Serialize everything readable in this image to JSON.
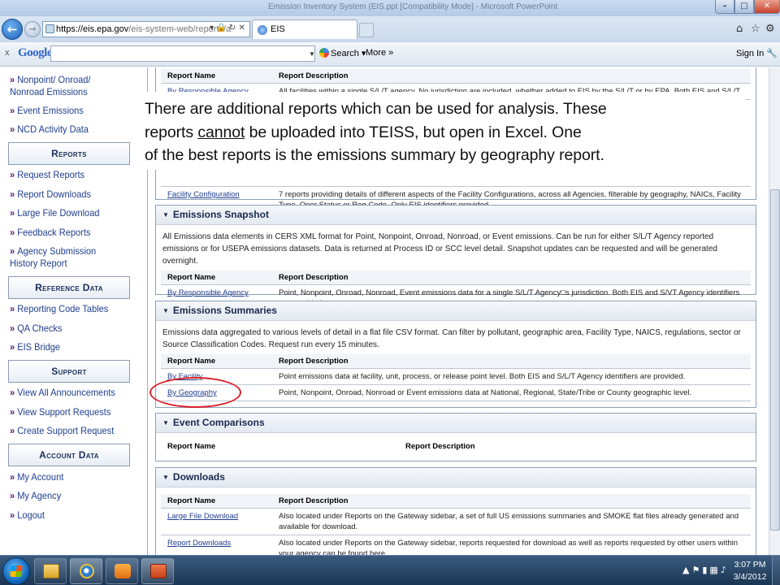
{
  "window": {
    "title": "Emission Inventory System (EIS.ppt [Compatibility Mode] - Microsoft PowerPoint"
  },
  "address_bar": {
    "url_host": "https://eis.epa.gov",
    "url_path": "/eis-system-web/reports/a",
    "tab_label": "EIS"
  },
  "google_toolbar": {
    "logo": "Google",
    "search_label": "Search",
    "more_label": "More »",
    "sign_in_label": "Sign In"
  },
  "sidebar": {
    "items_top": [
      {
        "label": "Nonpoint/ Onroad/ Nonroad Emissions"
      },
      {
        "label": "Event Emissions"
      },
      {
        "label": "NCD Activity Data"
      }
    ],
    "sections": [
      {
        "heading": "Reports",
        "items": [
          {
            "label": "Request Reports"
          },
          {
            "label": "Report Downloads"
          },
          {
            "label": "Large File Download"
          },
          {
            "label": "Feedback Reports"
          },
          {
            "label": "Agency Submission History Report"
          }
        ]
      },
      {
        "heading": "Reference Data",
        "items": [
          {
            "label": "Reporting Code Tables"
          },
          {
            "label": "QA Checks"
          },
          {
            "label": "EIS Bridge"
          }
        ]
      },
      {
        "heading": "Support",
        "items": [
          {
            "label": "View All Announcements"
          },
          {
            "label": "View Support Requests"
          },
          {
            "label": "Create Support Request"
          }
        ]
      },
      {
        "heading": "Account Data",
        "items": [
          {
            "label": "My Account"
          },
          {
            "label": "My Agency"
          },
          {
            "label": "Logout"
          }
        ]
      }
    ]
  },
  "top_table": {
    "col_name": "Report Name",
    "col_desc": "Report Description",
    "partial_row": {
      "name": "By Responsible Agency",
      "desc": "All facilities within a single S/L/T agency. No jurisdiction are included, whether added to EIS by the S/L/T or by EPA. Both EIS and S/L/T Agency identifiers are provided."
    },
    "facility_config": {
      "name": "Facility Configuration",
      "desc": "7 reports providing details of different aspects of the Facility Configurations, across all Agencies, filterable by geography, NAICs, Facility Type, Oper Status or Reg Code. Only EIS identifiers provided."
    }
  },
  "panels": {
    "snapshot": {
      "title": "Emissions Snapshot",
      "desc": "All Emissions data elements in CERS XML format for Point, Nonpoint, Onroad, Nonroad, or Event emissions. Can be run for either S/L/T Agency reported emissions or for USEPA emissions datasets. Data is returned at Process ID or SCC level detail. Snapshot updates can be requested and will be generated overnight.",
      "col_name": "Report Name",
      "col_desc": "Report Description",
      "rows": [
        {
          "name": "By Responsible Agency",
          "desc": "Point, Nonpoint, Onroad, Nonroad, Event emissions data for a single S/L/T Agency□s jurisdiction. Both EIS and S/VT Agency identifiers are provided."
        }
      ]
    },
    "summaries": {
      "title": "Emissions Summaries",
      "desc": "Emissions data aggregated to various levels of detail in a flat file CSV format. Can filter by pollutant, geographic area, Facility Type, NAICS, regulations, sector or Source Classification Codes. Request run every 15 minutes.",
      "col_name": "Report Name",
      "col_desc": "Report Description",
      "rows": [
        {
          "name": "By Facility",
          "desc": "Point emissions data at facility, unit, process, or release point level. Both EIS and S/L/T Agency identifiers are provided."
        },
        {
          "name": "By Geography",
          "desc": "Point, Nonpoint, Onroad, Nonroad or Event emissions data at National, Regional, State/Tribe or County geographic level."
        }
      ]
    },
    "comparisons": {
      "title": "Event Comparisons",
      "col_name": "Report Name",
      "col_desc": "Report Description"
    },
    "downloads": {
      "title": "Downloads",
      "col_name": "Report Name",
      "col_desc": "Report Description",
      "rows": [
        {
          "name": "Large File Download",
          "desc": "Also located under Reports on the Gateway sidebar, a set of full US emissions summaries and SMOKE flat files already generated and available for download."
        },
        {
          "name": "Report Downloads",
          "desc": "Also located under Reports on the Gateway sidebar, reports requested for download as well as reports requested by other users within your agency can be found here."
        }
      ]
    }
  },
  "callout": {
    "line1": "There are additional reports which can be used for analysis.  These",
    "line2_pre": "reports ",
    "line2_u": "cannot",
    "line2_post": " be uploaded into TEISS, but open in Excel.  One",
    "line3": "of the best reports is the emissions summary  by geography report."
  },
  "taskbar": {
    "time": "3:07 PM",
    "date": "3/4/2012"
  },
  "colors": {
    "link": "#1f3e8f",
    "highlight_ellipse": "#d8202a",
    "sidebar_bullet": "#5a1d6e"
  }
}
